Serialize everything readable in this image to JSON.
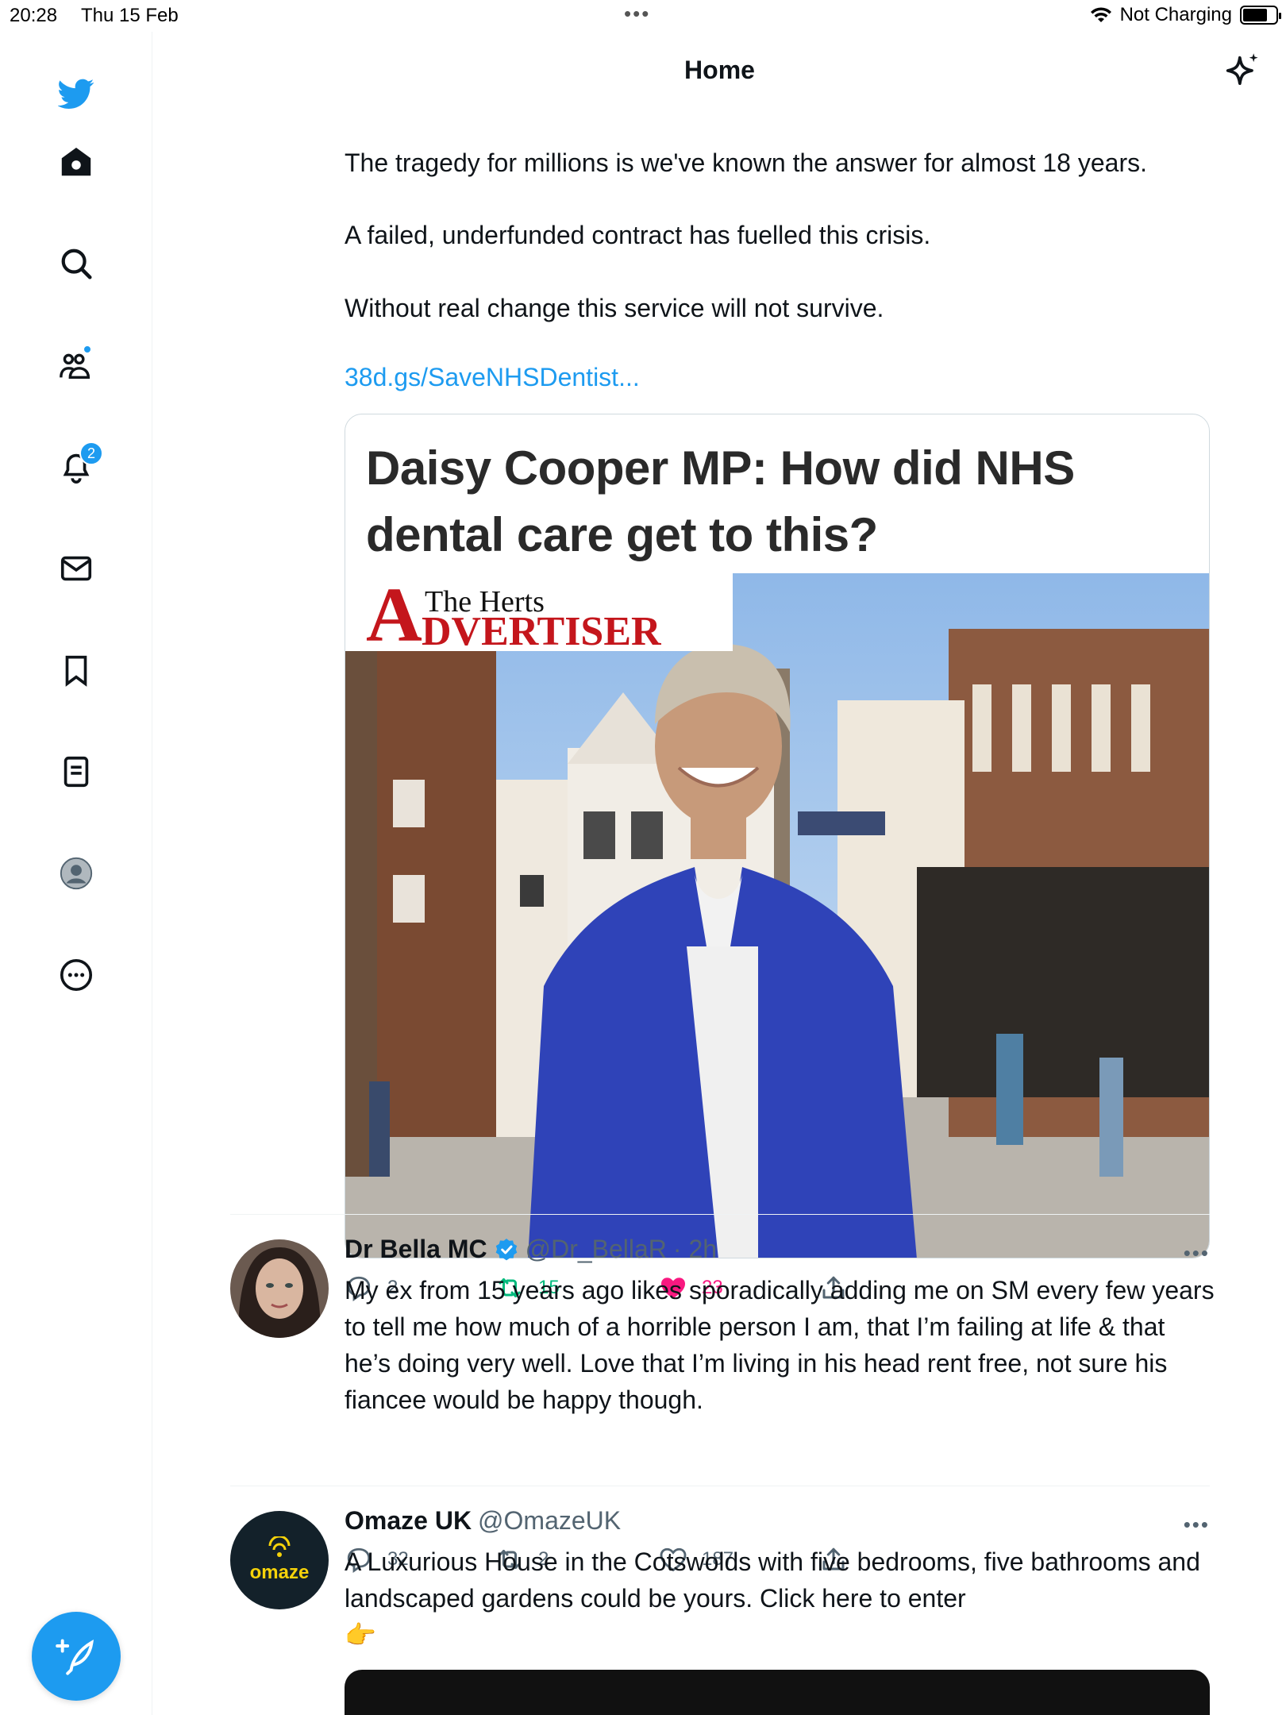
{
  "status_bar": {
    "time": "20:28",
    "date": "Thu 15 Feb",
    "dots": "•••",
    "charging": "Not Charging",
    "battery_level": 0.76
  },
  "sidebar": {
    "items": [
      {
        "name": "twitter-logo-icon"
      },
      {
        "name": "home-icon"
      },
      {
        "name": "search-icon"
      },
      {
        "name": "communities-icon"
      },
      {
        "name": "notifications-icon",
        "badge": "2"
      },
      {
        "name": "messages-icon"
      },
      {
        "name": "bookmarks-icon"
      },
      {
        "name": "lists-icon"
      },
      {
        "name": "profile-icon"
      },
      {
        "name": "more-icon"
      }
    ],
    "accent": "#1d9bf0"
  },
  "header": {
    "title": "Home"
  },
  "tweet1": {
    "para1": "The tragedy for millions is we've known the answer for almost 18 years.",
    "para2": "A failed, underfunded contract has fuelled this crisis.",
    "para3": "Without real change this service will not survive.",
    "link": "38d.gs/SaveNHSDentist...",
    "card_headline": "Daisy Cooper MP: How did NHS dental care get to this?",
    "masthead_the_herts": "The Herts",
    "masthead_a": "A",
    "masthead_dvertiser": "DVERTISER",
    "replies": "2",
    "retweets": "15",
    "likes": "23"
  },
  "tweet2": {
    "name": "Dr Bella MC",
    "handle": "@Dr_BellaR",
    "time": "· 2h",
    "more": "•••",
    "text": "My ex from 15 years ago likes sporadically adding me on SM every few years to tell me how much of a horrible person I am, that I’m failing at life & that he’s doing very well. Love that I’m living in his head rent free, not sure his fiancee would be happy though.",
    "replies": "32",
    "retweets": "2",
    "likes": "187"
  },
  "tweet3": {
    "name": "Omaze UK",
    "handle": "@OmazeUK",
    "more": "•••",
    "avatar_text": "omaze",
    "text": "A Luxurious House in the Cotswolds with five bedrooms, five bathrooms and landscaped gardens could be yours. Click here to enter",
    "emoji": "👉"
  }
}
